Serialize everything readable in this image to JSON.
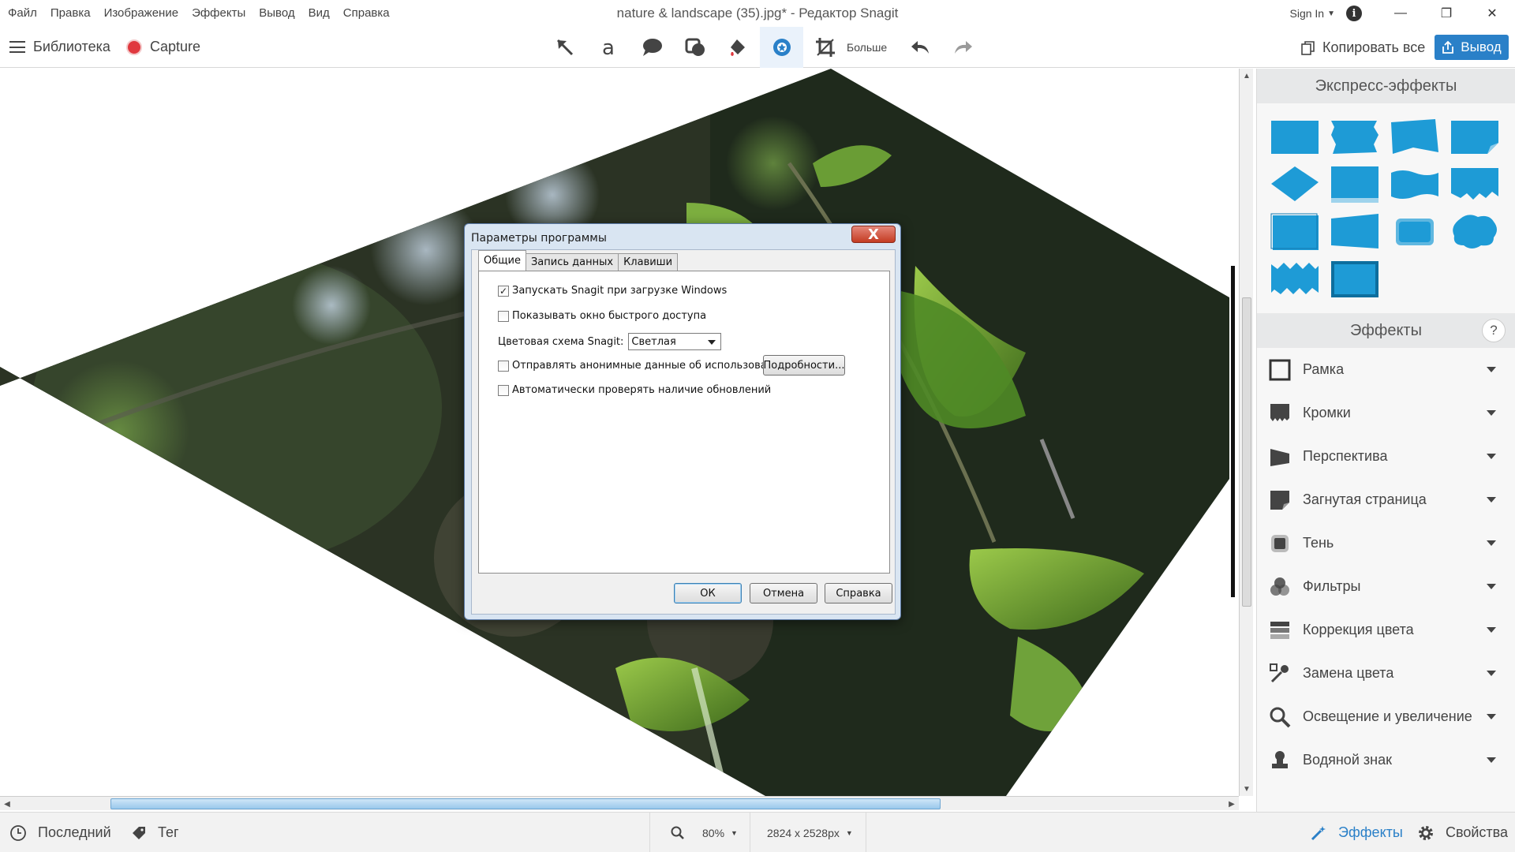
{
  "window": {
    "title": "nature & landscape (35).jpg* - Редактор Snagit",
    "sign_in": "Sign In",
    "info_glyph": "i",
    "minimize": "—",
    "restore": "❐",
    "close": "✕"
  },
  "menu": [
    "Файл",
    "Правка",
    "Изображение",
    "Эффекты",
    "Вывод",
    "Вид",
    "Справка"
  ],
  "toolbar": {
    "library": "Библиотека",
    "capture": "Capture",
    "more": "Больше",
    "copy_all": "Копировать все",
    "output": "Вывод",
    "tool_icons": [
      "arrow-icon",
      "text-icon",
      "callout-icon",
      "shape-icon",
      "fill-icon",
      "stamp-icon",
      "crop-icon",
      "undo-icon",
      "redo-icon"
    ]
  },
  "colors": {
    "accent": "#2a80c8",
    "capture_red": "#e0383e",
    "quick_style_blue": "#1e9bd6"
  },
  "panel": {
    "quick_styles_title": "Экспресс-эффекты",
    "effects_title": "Эффекты",
    "help_glyph": "?",
    "effects": [
      {
        "label": "Рамка",
        "icon": "border-icon"
      },
      {
        "label": "Кромки",
        "icon": "edges-icon"
      },
      {
        "label": "Перспектива",
        "icon": "perspective-icon"
      },
      {
        "label": "Загнутая страница",
        "icon": "page-curl-icon"
      },
      {
        "label": "Тень",
        "icon": "shadow-icon"
      },
      {
        "label": "Фильтры",
        "icon": "filters-icon"
      },
      {
        "label": "Коррекция цвета",
        "icon": "color-adjust-icon"
      },
      {
        "label": "Замена цвета",
        "icon": "color-replace-icon"
      },
      {
        "label": "Освещение и увеличение",
        "icon": "spotlight-magnify-icon"
      },
      {
        "label": "Водяной знак",
        "icon": "watermark-icon"
      }
    ]
  },
  "status": {
    "recent": "Последний",
    "tag": "Тег",
    "zoom": "80%",
    "size": "2824 x 2528px",
    "effects": "Эффекты",
    "properties": "Свойства"
  },
  "dialog": {
    "title": "Параметры программы",
    "close_glyph": "X",
    "tabs": [
      "Общие",
      "Запись данных",
      "Клавиши"
    ],
    "options": {
      "startup": {
        "label": "Запускать Snagit при загрузке Windows",
        "checked": true,
        "mark": "✓"
      },
      "quick_access": {
        "label": "Показывать окно быстрого доступа",
        "checked": false
      },
      "color_scheme_label": "Цветовая схема Snagit:",
      "color_scheme_value": "Светлая",
      "anonymous": {
        "label": "Отправлять анонимные данные об использовании",
        "checked": false
      },
      "details_button": "Подробности...",
      "updates": {
        "label": "Автоматически проверять наличие обновлений",
        "checked": false
      }
    },
    "buttons": {
      "ok": "ОК",
      "cancel": "Отмена",
      "help": "Справка"
    }
  }
}
